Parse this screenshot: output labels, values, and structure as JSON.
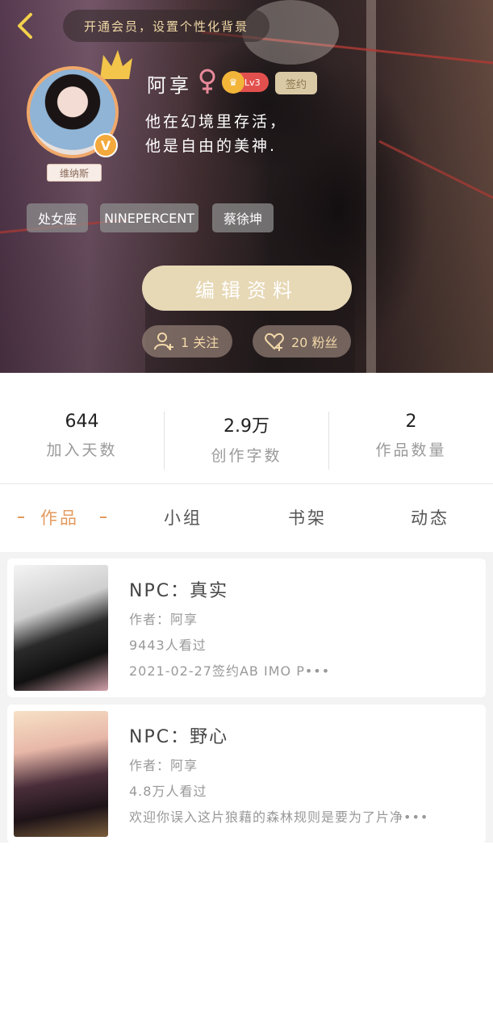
{
  "header": {
    "vip_banner": "开通会员，设置个性化背景",
    "avatar_nameplate": "维纳斯",
    "username": "阿享",
    "level": "Lv3",
    "sign_label": "签约",
    "bio_line1": "他在幻境里存活，",
    "bio_line2": "他是自由的美神.",
    "tags": [
      "处女座",
      "NINEPERCENT",
      "蔡徐坤"
    ],
    "edit_button": "编辑资料",
    "follow_label": "1 关注",
    "fans_label": "20 粉丝",
    "colors": {
      "accent": "#e39a5e",
      "edit_button_bg": "#e7d8b6",
      "vip_text": "#f1d9a6"
    }
  },
  "stats": [
    {
      "value": "644",
      "label": "加入天数"
    },
    {
      "value": "2.9万",
      "label": "创作字数"
    },
    {
      "value": "2",
      "label": "作品数量"
    }
  ],
  "tabs": [
    {
      "label": "作品",
      "active": true
    },
    {
      "label": "小组",
      "active": false
    },
    {
      "label": "书架",
      "active": false
    },
    {
      "label": "动态",
      "active": false
    }
  ],
  "works": [
    {
      "title": "NPC：真实",
      "author": "作者：阿享",
      "views": "9443人看过",
      "desc": "2021-02-27签约AB IMO P•••"
    },
    {
      "title": "NPC：野心",
      "author": "作者：阿享",
      "views": "4.8万人看过",
      "desc": "欢迎你误入这片狼藉的森林规则是要为了片净•••"
    }
  ]
}
